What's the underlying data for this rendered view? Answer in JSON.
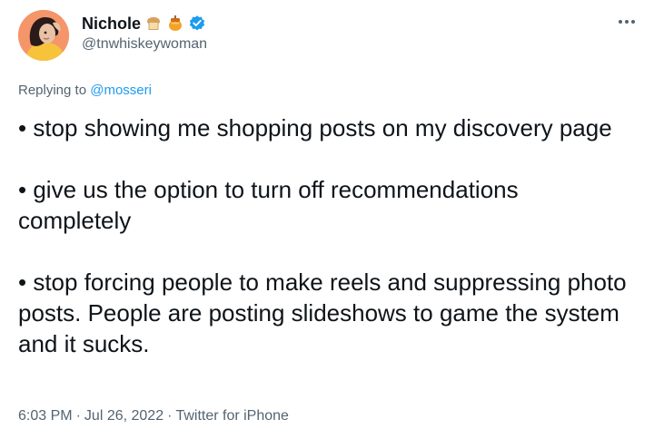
{
  "author": {
    "display_name": "Nichole",
    "handle": "@tnwhiskeywoman",
    "emoji_icons": [
      "bread-icon",
      "honey-pot-icon"
    ],
    "verified_icon": "verified-badge-icon",
    "avatar_icon": "avatar-icon"
  },
  "reply": {
    "prefix": "Replying to",
    "mention": "@mosseri"
  },
  "body": {
    "p1": "• stop showing me shopping posts on my discovery page",
    "p2": "• give us the option to turn off recommendations completely",
    "p3": "• stop forcing people to make reels and suppressing photo posts. People are posting slideshows to game the system and it sucks."
  },
  "meta": {
    "time": "6:03 PM",
    "separator": "·",
    "date": "Jul 26, 2022",
    "source": "Twitter for iPhone"
  },
  "colors": {
    "text": "#0f1419",
    "secondary": "#536471",
    "accent": "#1d9bf0"
  },
  "more_icon": "more-options-icon"
}
